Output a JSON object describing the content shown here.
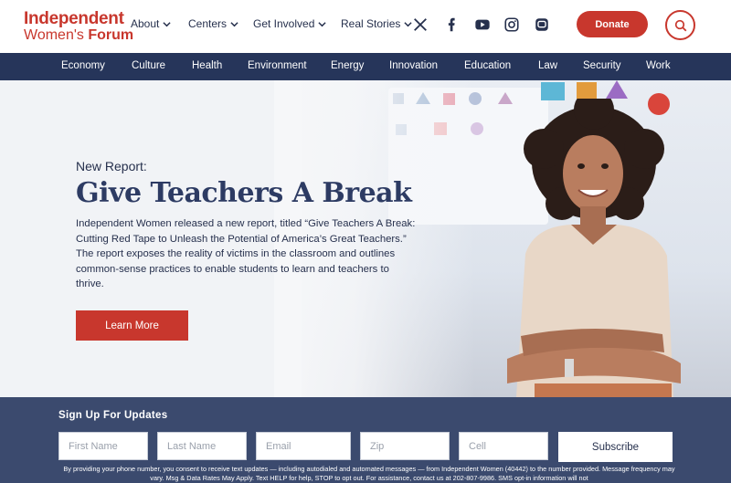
{
  "logo": {
    "line1": "Independent",
    "line2a": "Women's ",
    "line2b": "Forum"
  },
  "nav": [
    {
      "label": "About"
    },
    {
      "label": "Centers"
    },
    {
      "label": "Get Involved"
    },
    {
      "label": "Real Stories"
    }
  ],
  "social": [
    "x-icon",
    "facebook-icon",
    "youtube-icon",
    "instagram-icon",
    "chat-icon"
  ],
  "donate_label": "Donate",
  "categories": [
    "Economy",
    "Culture",
    "Health",
    "Environment",
    "Energy",
    "Innovation",
    "Education",
    "Law",
    "Security",
    "Work"
  ],
  "hero": {
    "kicker": "New Report:",
    "title": "Give Teachers A Break",
    "description": "Independent Women released a new report, titled “Give Teachers A Break: Cutting Red Tape to Unleash the Potential of America’s Great Teachers.” The report exposes the reality of victims in the classroom and outlines common-sense practices to enable students to learn and teachers to thrive.",
    "cta_label": "Learn More"
  },
  "signup": {
    "title": "Sign Up For Updates",
    "first_name_placeholder": "First Name",
    "last_name_placeholder": "Last Name",
    "email_placeholder": "Email",
    "zip_placeholder": "Zip",
    "cell_placeholder": "Cell",
    "subscribe_label": "Subscribe",
    "disclaimer": "By providing your phone number, you consent to receive text updates — including autodialed and automated messages — from Independent Women (40442) to the number provided. Message frequency may vary. Msg & Data Rates May Apply. Text HELP for help, STOP to opt out. For assistance, contact us at 202-807-9986. SMS opt-in information will not"
  },
  "colors": {
    "brand_red": "#c8372d",
    "navy": "#26355a",
    "signup_bg": "#3b4a6e"
  }
}
